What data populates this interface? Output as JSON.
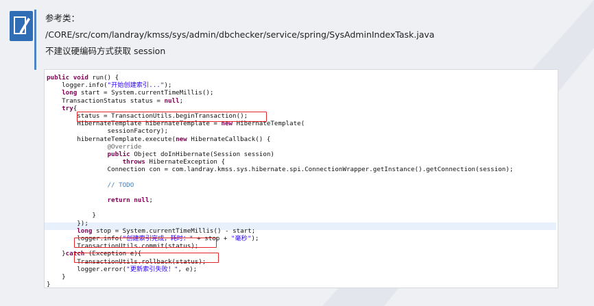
{
  "intro": {
    "reference_label": "参考类：",
    "path": "/CORE/src/com/landray/kmss/sys/admin/dbchecker/service/spring/SysAdminIndexTask.java",
    "advice": "不建议硬编码方式获取 session"
  },
  "icons": {
    "note": "pencil-note-icon"
  },
  "colors": {
    "accent": "#2f6db5",
    "highlight_box": "#e0262b",
    "keyword": "#7f0055",
    "string": "#2a00ff"
  },
  "code": {
    "lines": [
      [
        {
          "t": "public void",
          "c": "kw"
        },
        {
          "t": " run() {"
        }
      ],
      [
        {
          "t": "    logger.info("
        },
        {
          "t": "\"开始创建索引...\"",
          "c": "str"
        },
        {
          "t": ");"
        }
      ],
      [
        {
          "t": "    "
        },
        {
          "t": "long",
          "c": "kw"
        },
        {
          "t": " start = System.currentTimeMillis();"
        }
      ],
      [
        {
          "t": "    TransactionStatus status = "
        },
        {
          "t": "null",
          "c": "kw"
        },
        {
          "t": ";"
        }
      ],
      [
        {
          "t": "    "
        },
        {
          "t": "try",
          "c": "kw"
        },
        {
          "t": "{"
        }
      ],
      [
        {
          "t": "        status = TransactionUtils.beginTransaction();"
        }
      ],
      [
        {
          "t": "        HibernateTemplate hibernateTemplate = "
        },
        {
          "t": "new",
          "c": "kw"
        },
        {
          "t": " HibernateTemplate("
        }
      ],
      [
        {
          "t": "                sessionFactory);"
        }
      ],
      [
        {
          "t": "        hibernateTemplate.execute("
        },
        {
          "t": "new",
          "c": "kw"
        },
        {
          "t": " HibernateCallback() {"
        }
      ],
      [
        {
          "t": "                "
        },
        {
          "t": "@Override",
          "c": "an"
        }
      ],
      [
        {
          "t": "                "
        },
        {
          "t": "public",
          "c": "kw"
        },
        {
          "t": " Object doInHibernate(Session session)"
        }
      ],
      [
        {
          "t": "                    "
        },
        {
          "t": "throws",
          "c": "kw"
        },
        {
          "t": " HibernateException {"
        }
      ],
      [
        {
          "t": "                Connection con = com.landray.kmss.sys.hibernate.spi.ConnectionWrapper.getInstance().getConnection(session);"
        }
      ],
      [
        {
          "t": ""
        }
      ],
      [
        {
          "t": "                "
        },
        {
          "t": "// TODO",
          "c": "cm"
        }
      ],
      [
        {
          "t": ""
        }
      ],
      [
        {
          "t": "                "
        },
        {
          "t": "return null",
          "c": "kw"
        },
        {
          "t": ";"
        }
      ],
      [
        {
          "t": ""
        }
      ],
      [
        {
          "t": "            }"
        }
      ],
      [
        {
          "t": "        });"
        }
      ],
      [
        {
          "t": "        "
        },
        {
          "t": "long",
          "c": "kw"
        },
        {
          "t": " stop = System.currentTimeMillis() - start;"
        }
      ],
      [
        {
          "t": "        logger.info("
        },
        {
          "t": "\"创建索引完成，耗时：\"",
          "c": "str"
        },
        {
          "t": " + stop + "
        },
        {
          "t": "\"毫秒\"",
          "c": "str"
        },
        {
          "t": ");"
        }
      ],
      [
        {
          "t": "        TransactionUtils.commit(status);"
        }
      ],
      [
        {
          "t": "    }"
        },
        {
          "t": "catch",
          "c": "kw"
        },
        {
          "t": " (Exception e){"
        }
      ],
      [
        {
          "t": "        TransactionUtils.rollback(status);"
        }
      ],
      [
        {
          "t": "        logger.error("
        },
        {
          "t": "\"更新索引失败！\"",
          "c": "str"
        },
        {
          "t": ", e);"
        }
      ],
      [
        {
          "t": "    }"
        }
      ],
      [
        {
          "t": "}"
        }
      ]
    ]
  }
}
